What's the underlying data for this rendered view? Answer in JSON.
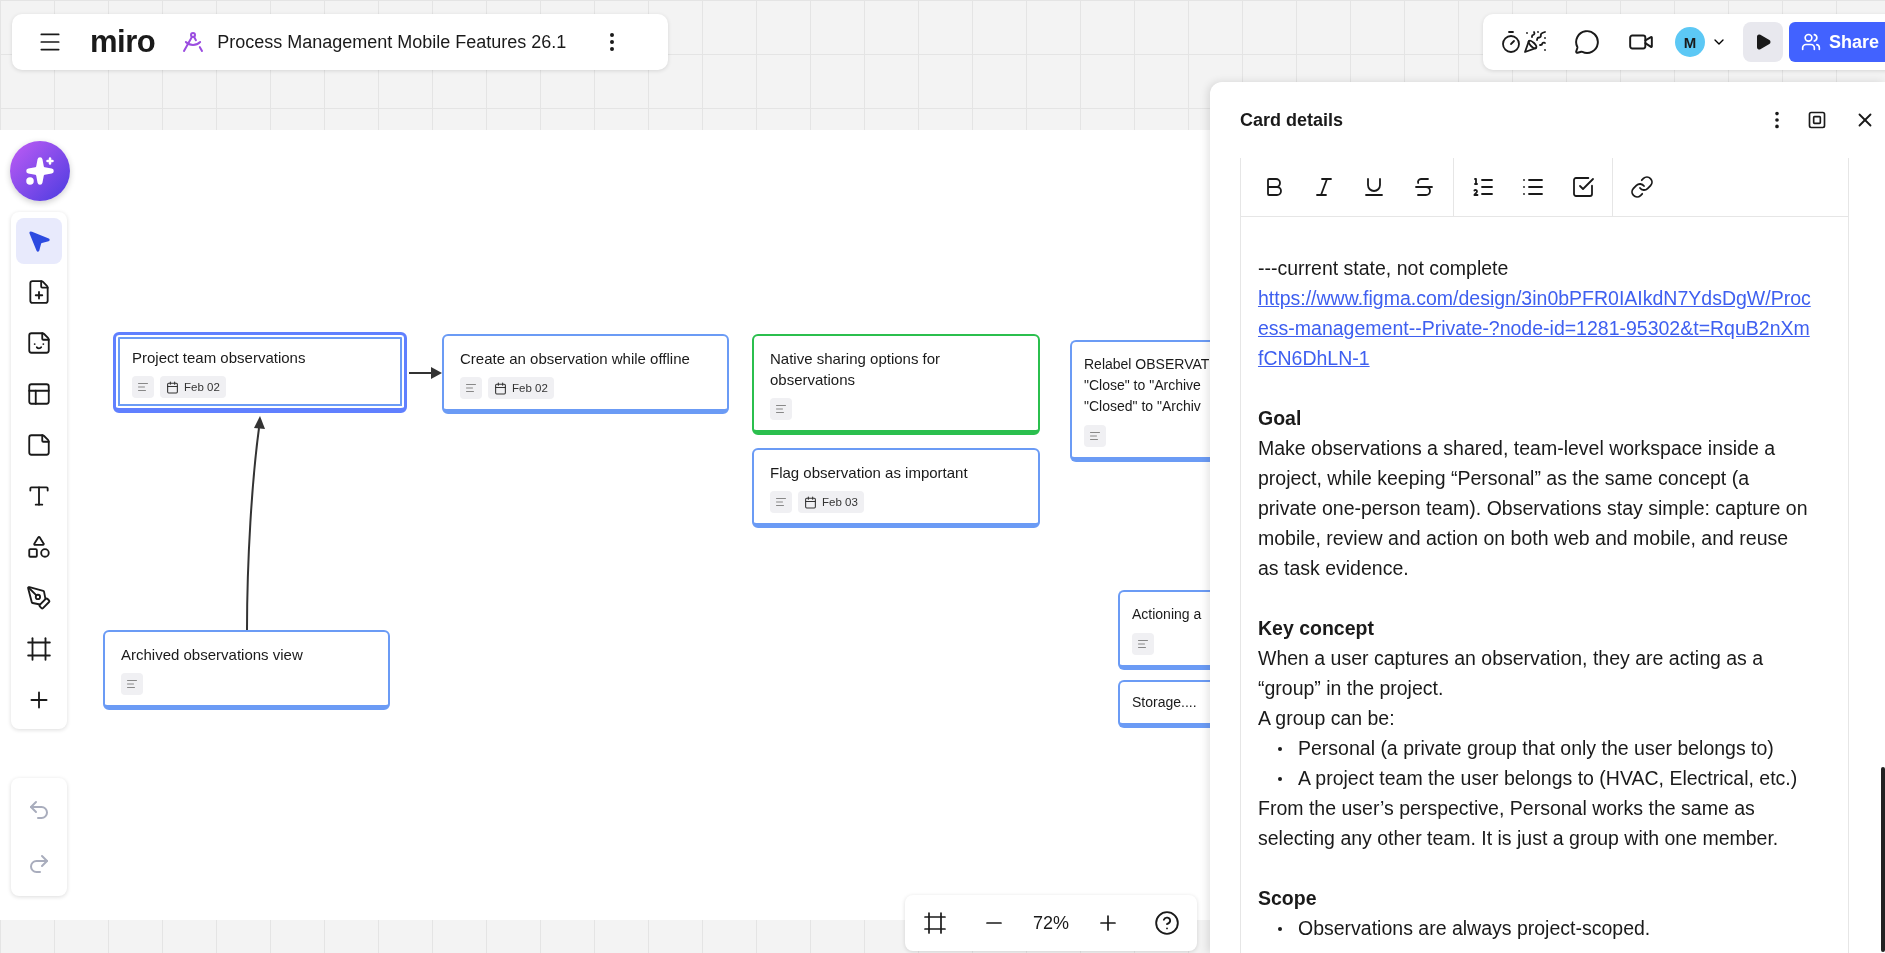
{
  "board": {
    "logo": "miro",
    "title": "Process Management Mobile Features 26.1"
  },
  "top_right": {
    "avatar": "M",
    "share": "Share"
  },
  "tools": [
    {
      "kind": "select",
      "selected": true
    },
    {
      "kind": "card",
      "selected": false
    },
    {
      "kind": "sticker",
      "selected": false
    },
    {
      "kind": "template",
      "selected": false
    },
    {
      "kind": "note",
      "selected": false
    },
    {
      "kind": "text",
      "selected": false
    },
    {
      "kind": "shapes",
      "selected": false
    },
    {
      "kind": "pen",
      "selected": false
    },
    {
      "kind": "frame",
      "selected": false
    },
    {
      "kind": "more",
      "selected": false
    }
  ],
  "cards": [
    {
      "title": "Project team observations",
      "date": "Feb 02",
      "color": "#6b9bf5",
      "selected": true
    },
    {
      "title": "Create an observation while offline",
      "date": "Feb 02",
      "color": "#6b9bf5",
      "selected": false
    },
    {
      "title": "Native sharing options for observations",
      "color": "#2bbf4e",
      "selected": false
    },
    {
      "title": "Flag observation as important",
      "date": "Feb 03",
      "color": "#6b9bf5",
      "selected": false
    },
    {
      "title": "Relabel OBSERVAT\n\"Close\" to \"Archive\n\"Closed\" to \"Archiv",
      "color": "#6b9bf5",
      "selected": false
    },
    {
      "title": "Actioning a",
      "color": "#6b9bf5",
      "selected": false
    },
    {
      "title": "Storage....",
      "color": "#6b9bf5",
      "selected": false,
      "description": false
    },
    {
      "title": "Archived observations view",
      "color": "#6b9bf5",
      "selected": false
    }
  ],
  "zoom": {
    "reading": "72%"
  },
  "panel": {
    "title": "Card details",
    "blocks": [
      {
        "kind": "text",
        "text": "---current state, not complete"
      },
      {
        "kind": "link",
        "text": "https://www.figma.com/design/3in0bPFR0IAIkdN7YdsDgW/Process-management--Private-?node-id=1281-95302&t=RquB2nXmfCN6DhLN-1"
      },
      {
        "kind": "heading",
        "text": "Goal"
      },
      {
        "kind": "text",
        "text": "Make observations a shared, team-level workspace inside a project, while keeping “Personal” as the same concept (a private one-person team). Observations stay simple: capture on mobile, review and action on both web and mobile, and reuse as task evidence."
      },
      {
        "kind": "heading",
        "text": "Key concept"
      },
      {
        "kind": "text",
        "text": "When a user captures an observation, they are acting as a “group” in the project."
      },
      {
        "kind": "text",
        "text": "A group can be:"
      },
      {
        "kind": "bullets",
        "items": [
          "Personal (a private group that only the user belongs to)",
          "A project team the user belongs to (HVAC, Electrical, etc.)"
        ]
      },
      {
        "kind": "text",
        "text": "From the user’s perspective, Personal works the same as selecting any other team. It is just a group with one member."
      },
      {
        "kind": "heading",
        "text": "Scope"
      },
      {
        "kind": "bullets",
        "items": [
          "Observations are always project-scoped."
        ]
      }
    ]
  }
}
